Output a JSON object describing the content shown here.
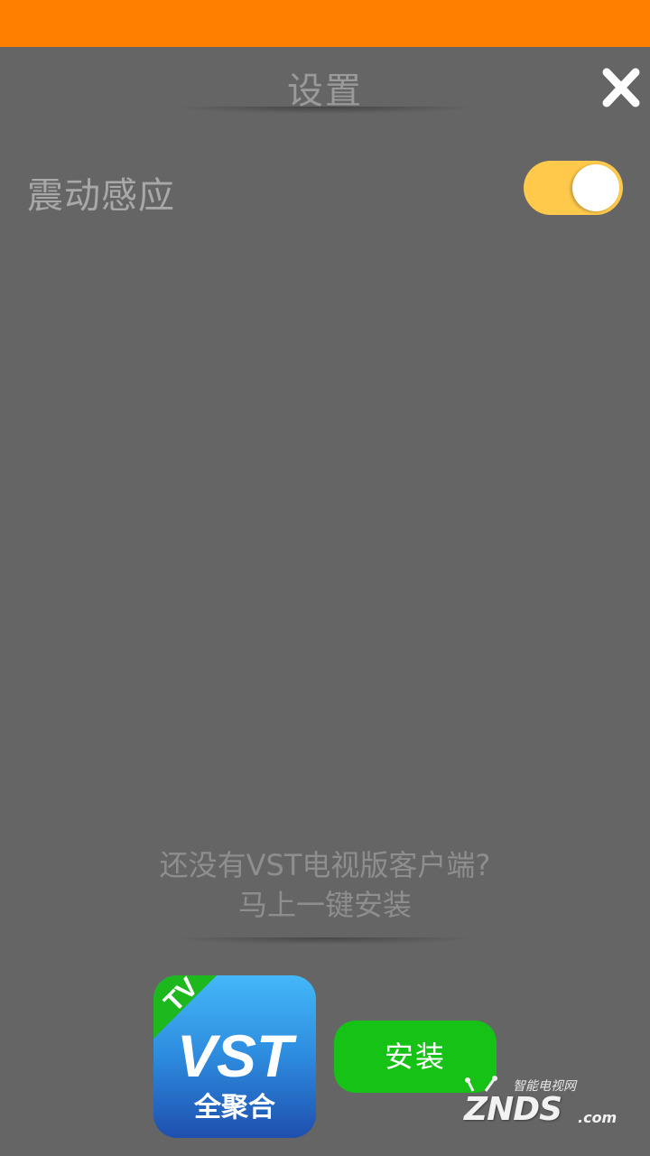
{
  "header": {
    "title": "设置",
    "close_icon": "close-icon"
  },
  "settings": {
    "vibration": {
      "label": "震动感应",
      "enabled": true,
      "toggle_color": "#ffc94c"
    }
  },
  "promo": {
    "line1": "还没有VST电视版客户端?",
    "line2": "马上一键安装"
  },
  "app": {
    "badge": "TV",
    "logo_text": "VST",
    "subtitle": "全聚合"
  },
  "install": {
    "label": "安装",
    "color": "#15c215"
  },
  "watermark": {
    "cn": "智能电视网",
    "logo": "ZNDS",
    "suffix": ".com"
  },
  "colors": {
    "status_bar": "#ff7f00",
    "background": "#656565"
  }
}
